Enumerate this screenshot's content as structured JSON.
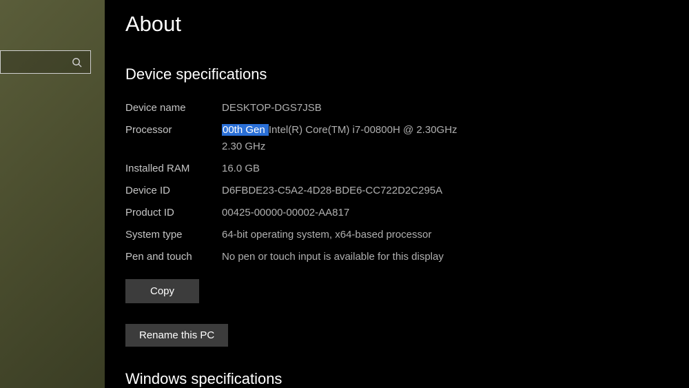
{
  "page": {
    "title": "About"
  },
  "search": {
    "placeholder": ""
  },
  "deviceSpecs": {
    "sectionTitle": "Device specifications",
    "rows": {
      "deviceName": {
        "label": "Device name",
        "value": "DESKTOP-DGS7JSB"
      },
      "processor": {
        "label": "Processor",
        "highlighted": "00th Gen ",
        "rest": "Intel(R) Core(TM) i7-00800H @ 2.30GHz",
        "line2": "2.30 GHz"
      },
      "installedRam": {
        "label": "Installed RAM",
        "value": "16.0 GB"
      },
      "deviceId": {
        "label": "Device ID",
        "value": "D6FBDE23-C5A2-4D28-BDE6-CC722D2C295A"
      },
      "productId": {
        "label": "Product ID",
        "value": "00425-00000-00002-AA817"
      },
      "systemType": {
        "label": "System type",
        "value": "64-bit operating system, x64-based processor"
      },
      "penTouch": {
        "label": "Pen and touch",
        "value": "No pen or touch input is available for this display"
      }
    },
    "copyButton": "Copy",
    "renameButton": "Rename this PC"
  },
  "windowsSpecs": {
    "sectionTitle": "Windows specifications"
  }
}
